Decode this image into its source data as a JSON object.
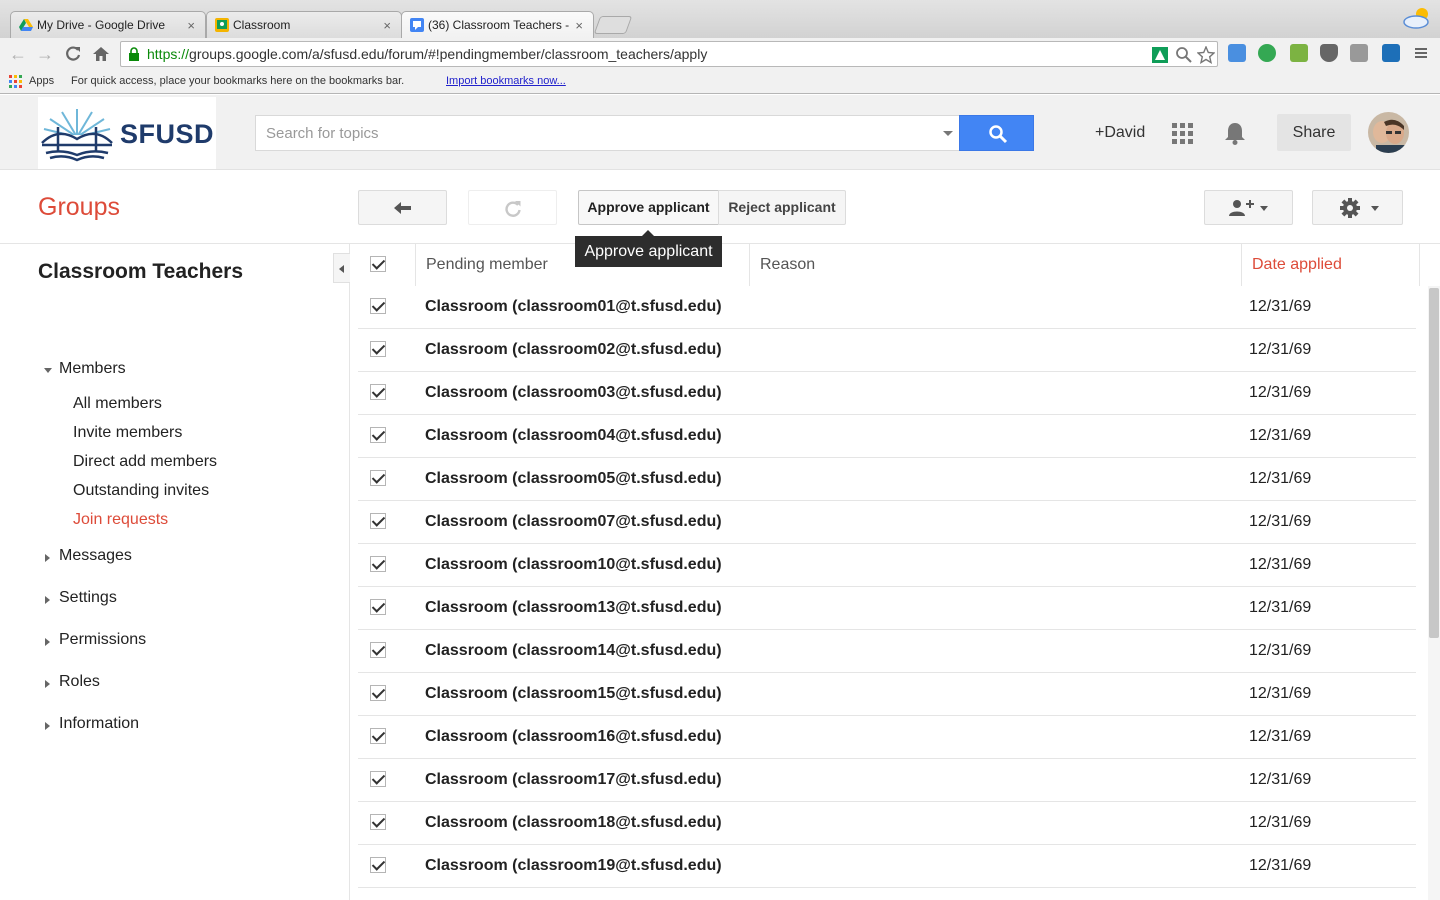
{
  "browser": {
    "tabs": [
      {
        "title": "My Drive - Google Drive",
        "close": "×"
      },
      {
        "title": "Classroom",
        "close": "×"
      },
      {
        "title": "(36) Classroom Teachers -",
        "close": "×"
      }
    ],
    "url_scheme": "https://",
    "url_rest": "groups.google.com/a/sfusd.edu/forum/#!pendingmember/classroom_teachers/apply",
    "bookmarks": {
      "apps": "Apps",
      "hint": "For quick access, place your bookmarks here on the bookmarks bar.",
      "import_link": "Import bookmarks now..."
    }
  },
  "header": {
    "logo_text": "SFUSD",
    "search_placeholder": "Search for topics",
    "user": "+David",
    "share": "Share"
  },
  "toolbar": {
    "groups_title": "Groups",
    "approve": "Approve applicant",
    "reject": "Reject applicant",
    "tooltip": "Approve applicant"
  },
  "sidebar": {
    "group_name": "Classroom Teachers",
    "members_label": "Members",
    "member_items": [
      "All members",
      "Invite members",
      "Direct add members",
      "Outstanding invites",
      "Join requests"
    ],
    "sections": [
      "Messages",
      "Settings",
      "Permissions",
      "Roles",
      "Information"
    ]
  },
  "table": {
    "columns": {
      "member": "Pending member",
      "reason": "Reason",
      "date": "Date applied"
    },
    "rows": [
      {
        "member": "Classroom (classroom01@t.sfusd.edu)",
        "date": "12/31/69"
      },
      {
        "member": "Classroom (classroom02@t.sfusd.edu)",
        "date": "12/31/69"
      },
      {
        "member": "Classroom (classroom03@t.sfusd.edu)",
        "date": "12/31/69"
      },
      {
        "member": "Classroom (classroom04@t.sfusd.edu)",
        "date": "12/31/69"
      },
      {
        "member": "Classroom (classroom05@t.sfusd.edu)",
        "date": "12/31/69"
      },
      {
        "member": "Classroom (classroom07@t.sfusd.edu)",
        "date": "12/31/69"
      },
      {
        "member": "Classroom (classroom10@t.sfusd.edu)",
        "date": "12/31/69"
      },
      {
        "member": "Classroom (classroom13@t.sfusd.edu)",
        "date": "12/31/69"
      },
      {
        "member": "Classroom (classroom14@t.sfusd.edu)",
        "date": "12/31/69"
      },
      {
        "member": "Classroom (classroom15@t.sfusd.edu)",
        "date": "12/31/69"
      },
      {
        "member": "Classroom (classroom16@t.sfusd.edu)",
        "date": "12/31/69"
      },
      {
        "member": "Classroom (classroom17@t.sfusd.edu)",
        "date": "12/31/69"
      },
      {
        "member": "Classroom (classroom18@t.sfusd.edu)",
        "date": "12/31/69"
      },
      {
        "member": "Classroom (classroom19@t.sfusd.edu)",
        "date": "12/31/69"
      }
    ]
  },
  "colors": {
    "brand_red": "#dd4b39",
    "search_blue": "#4285f4",
    "logo_navy": "#1f3b6b"
  }
}
